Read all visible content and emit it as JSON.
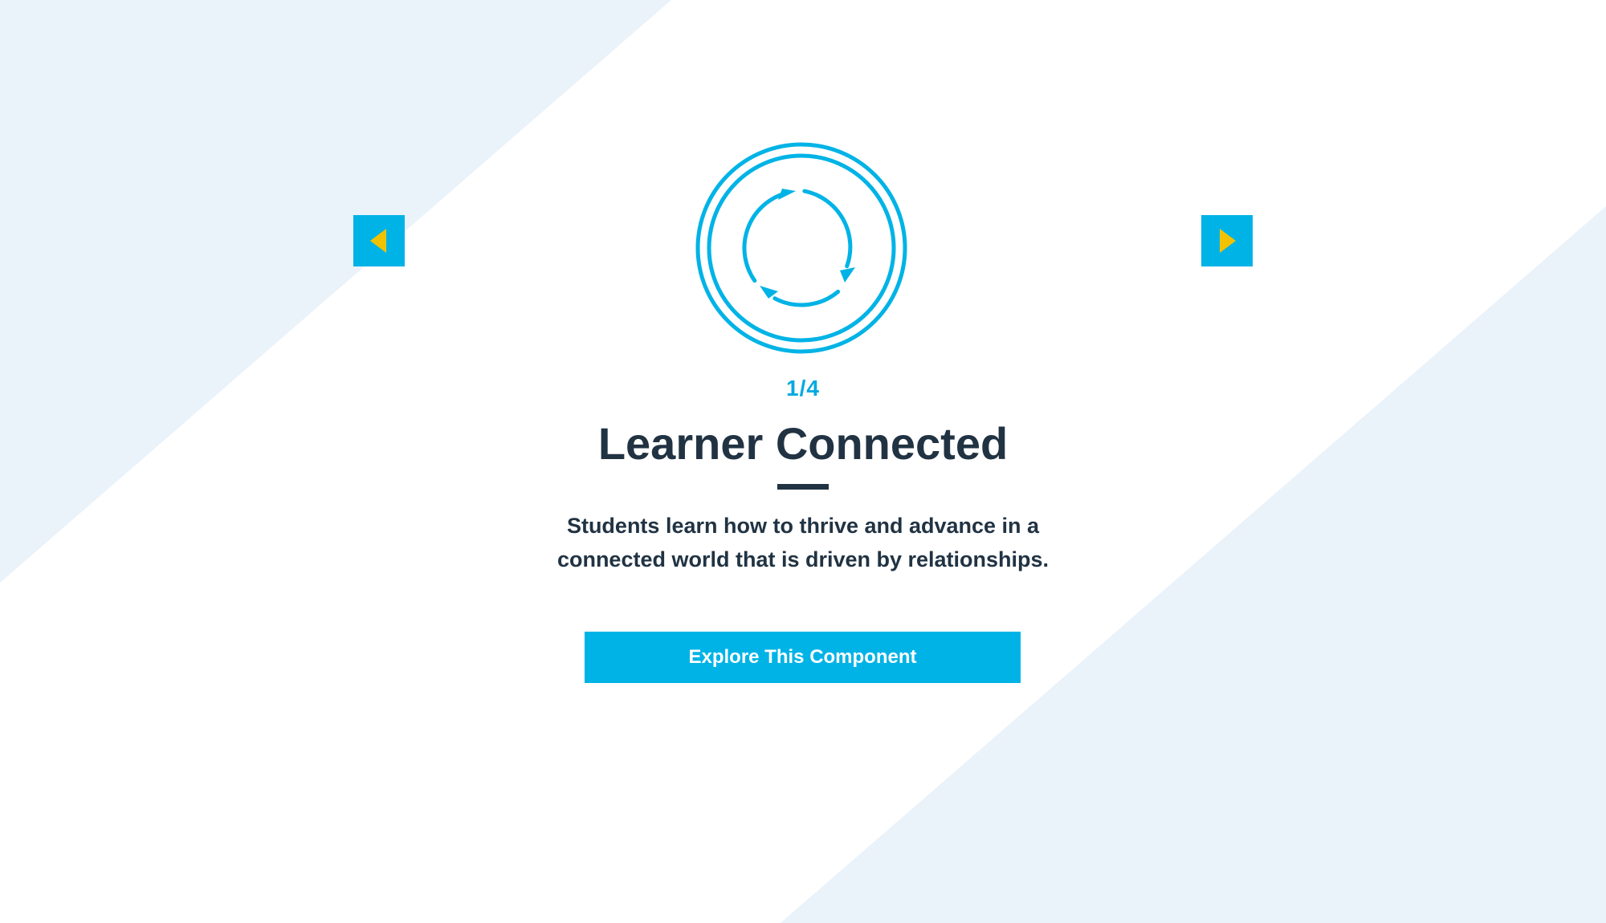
{
  "colors": {
    "accent": "#00b3e6",
    "arrow_glyph": "#f2c200",
    "heading": "#213343",
    "background_stripe": "#eaf2fa"
  },
  "carousel": {
    "counter": "1/4",
    "prev_icon": "triangle-left-icon",
    "next_icon": "triangle-right-icon"
  },
  "slide": {
    "icon": "cycle-arrows-icon",
    "title": "Learner Connected",
    "description": "Students learn how to thrive and advance in a connected world that is driven by relationships.",
    "cta_label": "Explore This Component"
  }
}
